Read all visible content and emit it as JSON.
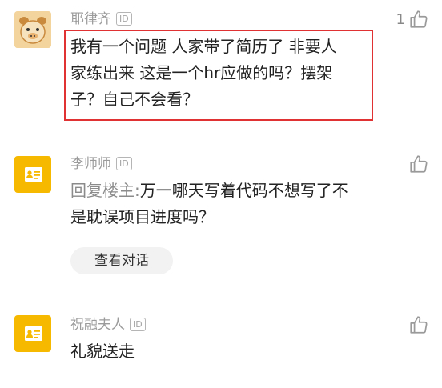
{
  "comments": [
    {
      "username": "耶律齐",
      "id_badge": "ID",
      "avatar_icon": "cartoon-animal-avatar",
      "text_lines": [
        "我有一个问题  人家带了简历了  非要人",
        "家练出来  这是一个hr应做的吗？摆架",
        "子？自己不会看？"
      ],
      "like_count": "1",
      "highlighted": true
    },
    {
      "username": "李师师",
      "id_badge": "ID",
      "avatar_icon": "person-card-icon",
      "reply_prefix": "回复楼主:",
      "text_lines": [
        "万一哪天写着代码不想写了不",
        "是耽误项目进度吗？"
      ],
      "view_conversation_label": "查看对话"
    },
    {
      "username": "祝融夫人",
      "id_badge": "ID",
      "avatar_icon": "person-card-icon",
      "text_lines": [
        "礼貌送走"
      ]
    }
  ],
  "colors": {
    "highlight_border": "#e03232",
    "avatar_yellow": "#f7b900",
    "muted_text": "#9b9b9b"
  }
}
